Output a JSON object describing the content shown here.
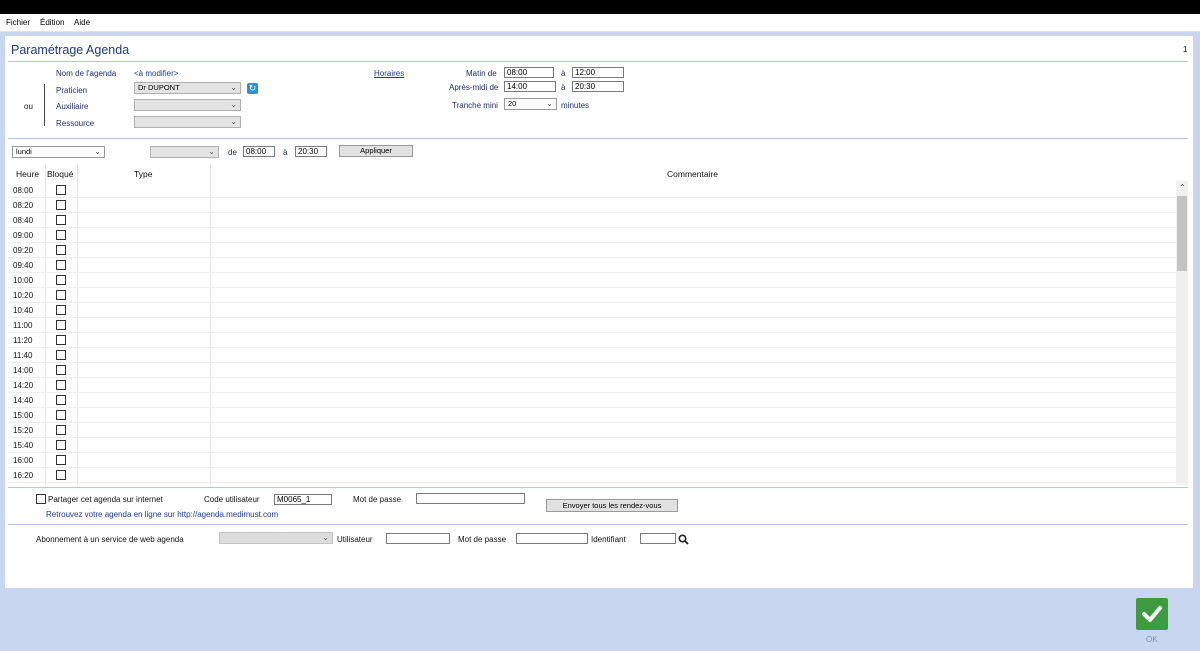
{
  "menubar": {
    "items": [
      "Fichier",
      "Édition",
      "Aide"
    ]
  },
  "title": "Paramétrage Agenda",
  "page_number": "1",
  "form": {
    "nom_label": "Nom de l'agenda",
    "nom_value": "<à modifier>",
    "ou_label": "ou",
    "praticien_label": "Praticien",
    "praticien_value": "Dr DUPONT",
    "auxiliaire_label": "Auxiliaire",
    "auxiliaire_value": "",
    "ressource_label": "Ressource",
    "ressource_value": "",
    "horaires_link": "Horaires",
    "matin_label": "Matin de",
    "matin_from": "08:00",
    "matin_a": "à",
    "matin_to": "12:00",
    "apres_label": "Après-midi de",
    "apres_from": "14:00",
    "apres_a": "à",
    "apres_to": "20:30",
    "tranche_label": "Tranche mini",
    "tranche_value": "20",
    "minutes_label": "minutes"
  },
  "filter": {
    "day_value": "lundi",
    "type_value": "",
    "de_label": "de",
    "from_value": "08:00",
    "a_label": "à",
    "to_value": "20:30",
    "apply_label": "Appliquer"
  },
  "grid": {
    "columns": [
      "Heure",
      "Bloqué",
      "Type",
      "Commentaire"
    ],
    "hours": [
      "08:00",
      "08:20",
      "08:40",
      "09:00",
      "09:20",
      "09:40",
      "10:00",
      "10:20",
      "10:40",
      "11:00",
      "11:20",
      "11:40",
      "14:00",
      "14:20",
      "14:40",
      "15:00",
      "15:20",
      "15:40",
      "16:00",
      "16:20"
    ]
  },
  "share": {
    "checkbox_label": "Partager cet agenda sur internet",
    "code_label": "Code utilisateur",
    "code_value": "M0065_1",
    "password_label": "Mot de passe",
    "password_value": "",
    "send_button": "Envoyer tous les rendez-vous",
    "info_text": "Retrouvez votre agenda en ligne sur http://agenda.medimust.com"
  },
  "web": {
    "subscription_label": "Abonnement à un service de web agenda",
    "service_value": "",
    "user_label": "Utilisateur",
    "user_value": "",
    "password_label": "Mot de passe",
    "password_value": "",
    "id_label": "Identifiant",
    "id_value": ""
  },
  "ok_label": "OK",
  "colors": {
    "title": "#1f3b78",
    "background": "#c9d6ef",
    "ok_button": "#3e9b40",
    "refresh_button": "#2d8fd9"
  },
  "icons": [
    "refresh-icon",
    "chevron-down-icon",
    "checkbox-icon",
    "search-icon",
    "checkmark-icon",
    "scroll-up-icon"
  ]
}
